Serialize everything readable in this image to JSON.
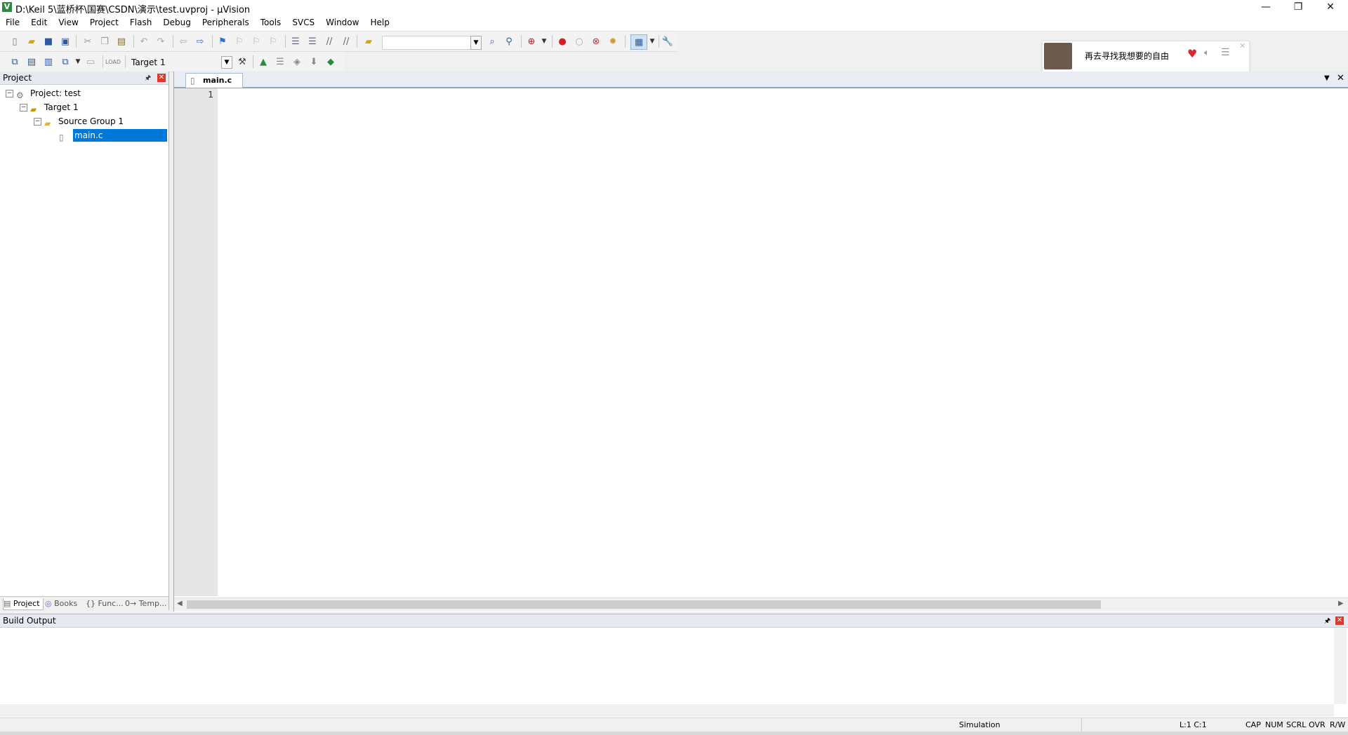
{
  "window": {
    "title": "D:\\Keil 5\\蓝桥杯\\国赛\\CSDN\\演示\\test.uvproj - µVision",
    "app_icon": "V",
    "controls": [
      "—",
      "❐",
      "✕"
    ]
  },
  "menu": [
    "File",
    "Edit",
    "View",
    "Project",
    "Flash",
    "Debug",
    "Peripherals",
    "Tools",
    "SVCS",
    "Window",
    "Help"
  ],
  "build_toolbar": {
    "target_select": "Target 1"
  },
  "music_widget": {
    "song": "再去寻找我想要的自由",
    "icons": [
      "heart-icon",
      "speaker-icon",
      "playlist-icon"
    ],
    "heart_color": "#d62b2b"
  },
  "project_panel": {
    "title": "Project",
    "tree": {
      "project_label": "Project: test",
      "target_label": "Target 1",
      "group_label": "Source Group 1",
      "file_label": "main.c"
    },
    "tabs": [
      "Project",
      "Books",
      "{} Func...",
      "0→ Temp..."
    ]
  },
  "editor": {
    "active_tab": "main.c",
    "line_numbers": [
      "1"
    ]
  },
  "build_output": {
    "title": "Build Output"
  },
  "status_bar": {
    "mode": "Simulation",
    "position": "L:1 C:1",
    "indicators": [
      "CAP",
      "NUM",
      "SCRL",
      "OVR",
      "R/W"
    ]
  },
  "colors": {
    "selection": "#0078d7",
    "panel_header": "#e6eaf0",
    "tab_active_border": "#8fa6c6"
  }
}
